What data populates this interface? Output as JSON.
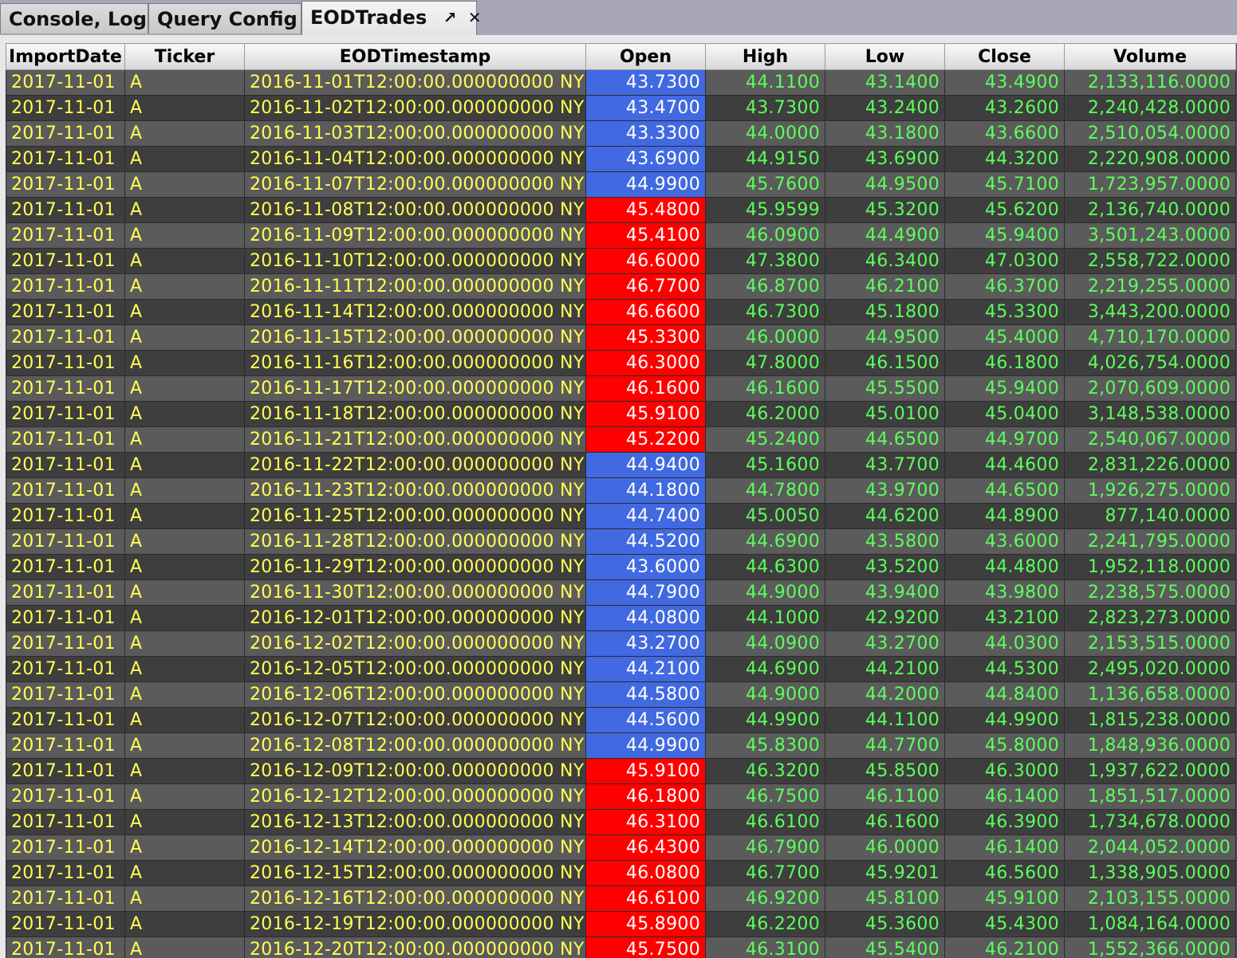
{
  "tabs": [
    {
      "label": "Console, Log",
      "active": false
    },
    {
      "label": "Query Config",
      "active": false
    },
    {
      "label": "EODTrades",
      "active": true
    }
  ],
  "tab_icons": {
    "undock": "undock-arrow-icon",
    "close": "close-icon"
  },
  "colors": {
    "text_yellow": "#ffff55",
    "text_green": "#5cff5c",
    "open_up": "#4169e1",
    "open_down": "#ff0000",
    "row_odd": "#5b5b5b",
    "row_even": "#3e3e3e"
  },
  "table": {
    "columns": [
      "ImportDate",
      "Ticker",
      "EODTimestamp",
      "Open",
      "High",
      "Low",
      "Close",
      "Volume"
    ],
    "rows": [
      {
        "ImportDate": "2017-11-01",
        "Ticker": "A",
        "EODTimestamp": "2016-11-01T12:00:00.000000000 NY",
        "Open": "43.7300",
        "High": "44.1100",
        "Low": "43.1400",
        "Close": "43.4900",
        "Volume": "2,133,116.0000",
        "open_color": "blue"
      },
      {
        "ImportDate": "2017-11-01",
        "Ticker": "A",
        "EODTimestamp": "2016-11-02T12:00:00.000000000 NY",
        "Open": "43.4700",
        "High": "43.7300",
        "Low": "43.2400",
        "Close": "43.2600",
        "Volume": "2,240,428.0000",
        "open_color": "blue"
      },
      {
        "ImportDate": "2017-11-01",
        "Ticker": "A",
        "EODTimestamp": "2016-11-03T12:00:00.000000000 NY",
        "Open": "43.3300",
        "High": "44.0000",
        "Low": "43.1800",
        "Close": "43.6600",
        "Volume": "2,510,054.0000",
        "open_color": "blue"
      },
      {
        "ImportDate": "2017-11-01",
        "Ticker": "A",
        "EODTimestamp": "2016-11-04T12:00:00.000000000 NY",
        "Open": "43.6900",
        "High": "44.9150",
        "Low": "43.6900",
        "Close": "44.3200",
        "Volume": "2,220,908.0000",
        "open_color": "blue"
      },
      {
        "ImportDate": "2017-11-01",
        "Ticker": "A",
        "EODTimestamp": "2016-11-07T12:00:00.000000000 NY",
        "Open": "44.9900",
        "High": "45.7600",
        "Low": "44.9500",
        "Close": "45.7100",
        "Volume": "1,723,957.0000",
        "open_color": "blue"
      },
      {
        "ImportDate": "2017-11-01",
        "Ticker": "A",
        "EODTimestamp": "2016-11-08T12:00:00.000000000 NY",
        "Open": "45.4800",
        "High": "45.9599",
        "Low": "45.3200",
        "Close": "45.6200",
        "Volume": "2,136,740.0000",
        "open_color": "red"
      },
      {
        "ImportDate": "2017-11-01",
        "Ticker": "A",
        "EODTimestamp": "2016-11-09T12:00:00.000000000 NY",
        "Open": "45.4100",
        "High": "46.0900",
        "Low": "44.4900",
        "Close": "45.9400",
        "Volume": "3,501,243.0000",
        "open_color": "red"
      },
      {
        "ImportDate": "2017-11-01",
        "Ticker": "A",
        "EODTimestamp": "2016-11-10T12:00:00.000000000 NY",
        "Open": "46.6000",
        "High": "47.3800",
        "Low": "46.3400",
        "Close": "47.0300",
        "Volume": "2,558,722.0000",
        "open_color": "red"
      },
      {
        "ImportDate": "2017-11-01",
        "Ticker": "A",
        "EODTimestamp": "2016-11-11T12:00:00.000000000 NY",
        "Open": "46.7700",
        "High": "46.8700",
        "Low": "46.2100",
        "Close": "46.3700",
        "Volume": "2,219,255.0000",
        "open_color": "red"
      },
      {
        "ImportDate": "2017-11-01",
        "Ticker": "A",
        "EODTimestamp": "2016-11-14T12:00:00.000000000 NY",
        "Open": "46.6600",
        "High": "46.7300",
        "Low": "45.1800",
        "Close": "45.3300",
        "Volume": "3,443,200.0000",
        "open_color": "red"
      },
      {
        "ImportDate": "2017-11-01",
        "Ticker": "A",
        "EODTimestamp": "2016-11-15T12:00:00.000000000 NY",
        "Open": "45.3300",
        "High": "46.0000",
        "Low": "44.9500",
        "Close": "45.4000",
        "Volume": "4,710,170.0000",
        "open_color": "red"
      },
      {
        "ImportDate": "2017-11-01",
        "Ticker": "A",
        "EODTimestamp": "2016-11-16T12:00:00.000000000 NY",
        "Open": "46.3000",
        "High": "47.8000",
        "Low": "46.1500",
        "Close": "46.1800",
        "Volume": "4,026,754.0000",
        "open_color": "red"
      },
      {
        "ImportDate": "2017-11-01",
        "Ticker": "A",
        "EODTimestamp": "2016-11-17T12:00:00.000000000 NY",
        "Open": "46.1600",
        "High": "46.1600",
        "Low": "45.5500",
        "Close": "45.9400",
        "Volume": "2,070,609.0000",
        "open_color": "red"
      },
      {
        "ImportDate": "2017-11-01",
        "Ticker": "A",
        "EODTimestamp": "2016-11-18T12:00:00.000000000 NY",
        "Open": "45.9100",
        "High": "46.2000",
        "Low": "45.0100",
        "Close": "45.0400",
        "Volume": "3,148,538.0000",
        "open_color": "red"
      },
      {
        "ImportDate": "2017-11-01",
        "Ticker": "A",
        "EODTimestamp": "2016-11-21T12:00:00.000000000 NY",
        "Open": "45.2200",
        "High": "45.2400",
        "Low": "44.6500",
        "Close": "44.9700",
        "Volume": "2,540,067.0000",
        "open_color": "red"
      },
      {
        "ImportDate": "2017-11-01",
        "Ticker": "A",
        "EODTimestamp": "2016-11-22T12:00:00.000000000 NY",
        "Open": "44.9400",
        "High": "45.1600",
        "Low": "43.7700",
        "Close": "44.4600",
        "Volume": "2,831,226.0000",
        "open_color": "blue"
      },
      {
        "ImportDate": "2017-11-01",
        "Ticker": "A",
        "EODTimestamp": "2016-11-23T12:00:00.000000000 NY",
        "Open": "44.1800",
        "High": "44.7800",
        "Low": "43.9700",
        "Close": "44.6500",
        "Volume": "1,926,275.0000",
        "open_color": "blue"
      },
      {
        "ImportDate": "2017-11-01",
        "Ticker": "A",
        "EODTimestamp": "2016-11-25T12:00:00.000000000 NY",
        "Open": "44.7400",
        "High": "45.0050",
        "Low": "44.6200",
        "Close": "44.8900",
        "Volume": "877,140.0000",
        "open_color": "blue"
      },
      {
        "ImportDate": "2017-11-01",
        "Ticker": "A",
        "EODTimestamp": "2016-11-28T12:00:00.000000000 NY",
        "Open": "44.5200",
        "High": "44.6900",
        "Low": "43.5800",
        "Close": "43.6000",
        "Volume": "2,241,795.0000",
        "open_color": "blue"
      },
      {
        "ImportDate": "2017-11-01",
        "Ticker": "A",
        "EODTimestamp": "2016-11-29T12:00:00.000000000 NY",
        "Open": "43.6000",
        "High": "44.6300",
        "Low": "43.5200",
        "Close": "44.4800",
        "Volume": "1,952,118.0000",
        "open_color": "blue"
      },
      {
        "ImportDate": "2017-11-01",
        "Ticker": "A",
        "EODTimestamp": "2016-11-30T12:00:00.000000000 NY",
        "Open": "44.7900",
        "High": "44.9000",
        "Low": "43.9400",
        "Close": "43.9800",
        "Volume": "2,238,575.0000",
        "open_color": "blue"
      },
      {
        "ImportDate": "2017-11-01",
        "Ticker": "A",
        "EODTimestamp": "2016-12-01T12:00:00.000000000 NY",
        "Open": "44.0800",
        "High": "44.1000",
        "Low": "42.9200",
        "Close": "43.2100",
        "Volume": "2,823,273.0000",
        "open_color": "blue"
      },
      {
        "ImportDate": "2017-11-01",
        "Ticker": "A",
        "EODTimestamp": "2016-12-02T12:00:00.000000000 NY",
        "Open": "43.2700",
        "High": "44.0900",
        "Low": "43.2700",
        "Close": "44.0300",
        "Volume": "2,153,515.0000",
        "open_color": "blue"
      },
      {
        "ImportDate": "2017-11-01",
        "Ticker": "A",
        "EODTimestamp": "2016-12-05T12:00:00.000000000 NY",
        "Open": "44.2100",
        "High": "44.6900",
        "Low": "44.2100",
        "Close": "44.5300",
        "Volume": "2,495,020.0000",
        "open_color": "blue"
      },
      {
        "ImportDate": "2017-11-01",
        "Ticker": "A",
        "EODTimestamp": "2016-12-06T12:00:00.000000000 NY",
        "Open": "44.5800",
        "High": "44.9000",
        "Low": "44.2000",
        "Close": "44.8400",
        "Volume": "1,136,658.0000",
        "open_color": "blue"
      },
      {
        "ImportDate": "2017-11-01",
        "Ticker": "A",
        "EODTimestamp": "2016-12-07T12:00:00.000000000 NY",
        "Open": "44.5600",
        "High": "44.9900",
        "Low": "44.1100",
        "Close": "44.9900",
        "Volume": "1,815,238.0000",
        "open_color": "blue"
      },
      {
        "ImportDate": "2017-11-01",
        "Ticker": "A",
        "EODTimestamp": "2016-12-08T12:00:00.000000000 NY",
        "Open": "44.9900",
        "High": "45.8300",
        "Low": "44.7700",
        "Close": "45.8000",
        "Volume": "1,848,936.0000",
        "open_color": "blue"
      },
      {
        "ImportDate": "2017-11-01",
        "Ticker": "A",
        "EODTimestamp": "2016-12-09T12:00:00.000000000 NY",
        "Open": "45.9100",
        "High": "46.3200",
        "Low": "45.8500",
        "Close": "46.3000",
        "Volume": "1,937,622.0000",
        "open_color": "red"
      },
      {
        "ImportDate": "2017-11-01",
        "Ticker": "A",
        "EODTimestamp": "2016-12-12T12:00:00.000000000 NY",
        "Open": "46.1800",
        "High": "46.7500",
        "Low": "46.1100",
        "Close": "46.1400",
        "Volume": "1,851,517.0000",
        "open_color": "red"
      },
      {
        "ImportDate": "2017-11-01",
        "Ticker": "A",
        "EODTimestamp": "2016-12-13T12:00:00.000000000 NY",
        "Open": "46.3100",
        "High": "46.6100",
        "Low": "46.1600",
        "Close": "46.3900",
        "Volume": "1,734,678.0000",
        "open_color": "red"
      },
      {
        "ImportDate": "2017-11-01",
        "Ticker": "A",
        "EODTimestamp": "2016-12-14T12:00:00.000000000 NY",
        "Open": "46.4300",
        "High": "46.7900",
        "Low": "46.0000",
        "Close": "46.1400",
        "Volume": "2,044,052.0000",
        "open_color": "red"
      },
      {
        "ImportDate": "2017-11-01",
        "Ticker": "A",
        "EODTimestamp": "2016-12-15T12:00:00.000000000 NY",
        "Open": "46.0800",
        "High": "46.7700",
        "Low": "45.9201",
        "Close": "46.5600",
        "Volume": "1,338,905.0000",
        "open_color": "red"
      },
      {
        "ImportDate": "2017-11-01",
        "Ticker": "A",
        "EODTimestamp": "2016-12-16T12:00:00.000000000 NY",
        "Open": "46.6100",
        "High": "46.9200",
        "Low": "45.8100",
        "Close": "45.9100",
        "Volume": "2,103,155.0000",
        "open_color": "red"
      },
      {
        "ImportDate": "2017-11-01",
        "Ticker": "A",
        "EODTimestamp": "2016-12-19T12:00:00.000000000 NY",
        "Open": "45.8900",
        "High": "46.2200",
        "Low": "45.3600",
        "Close": "45.4300",
        "Volume": "1,084,164.0000",
        "open_color": "red"
      },
      {
        "ImportDate": "2017-11-01",
        "Ticker": "A",
        "EODTimestamp": "2016-12-20T12:00:00.000000000 NY",
        "Open": "45.7500",
        "High": "46.3100",
        "Low": "45.5400",
        "Close": "46.2100",
        "Volume": "1,552,366.0000",
        "open_color": "red"
      }
    ]
  }
}
